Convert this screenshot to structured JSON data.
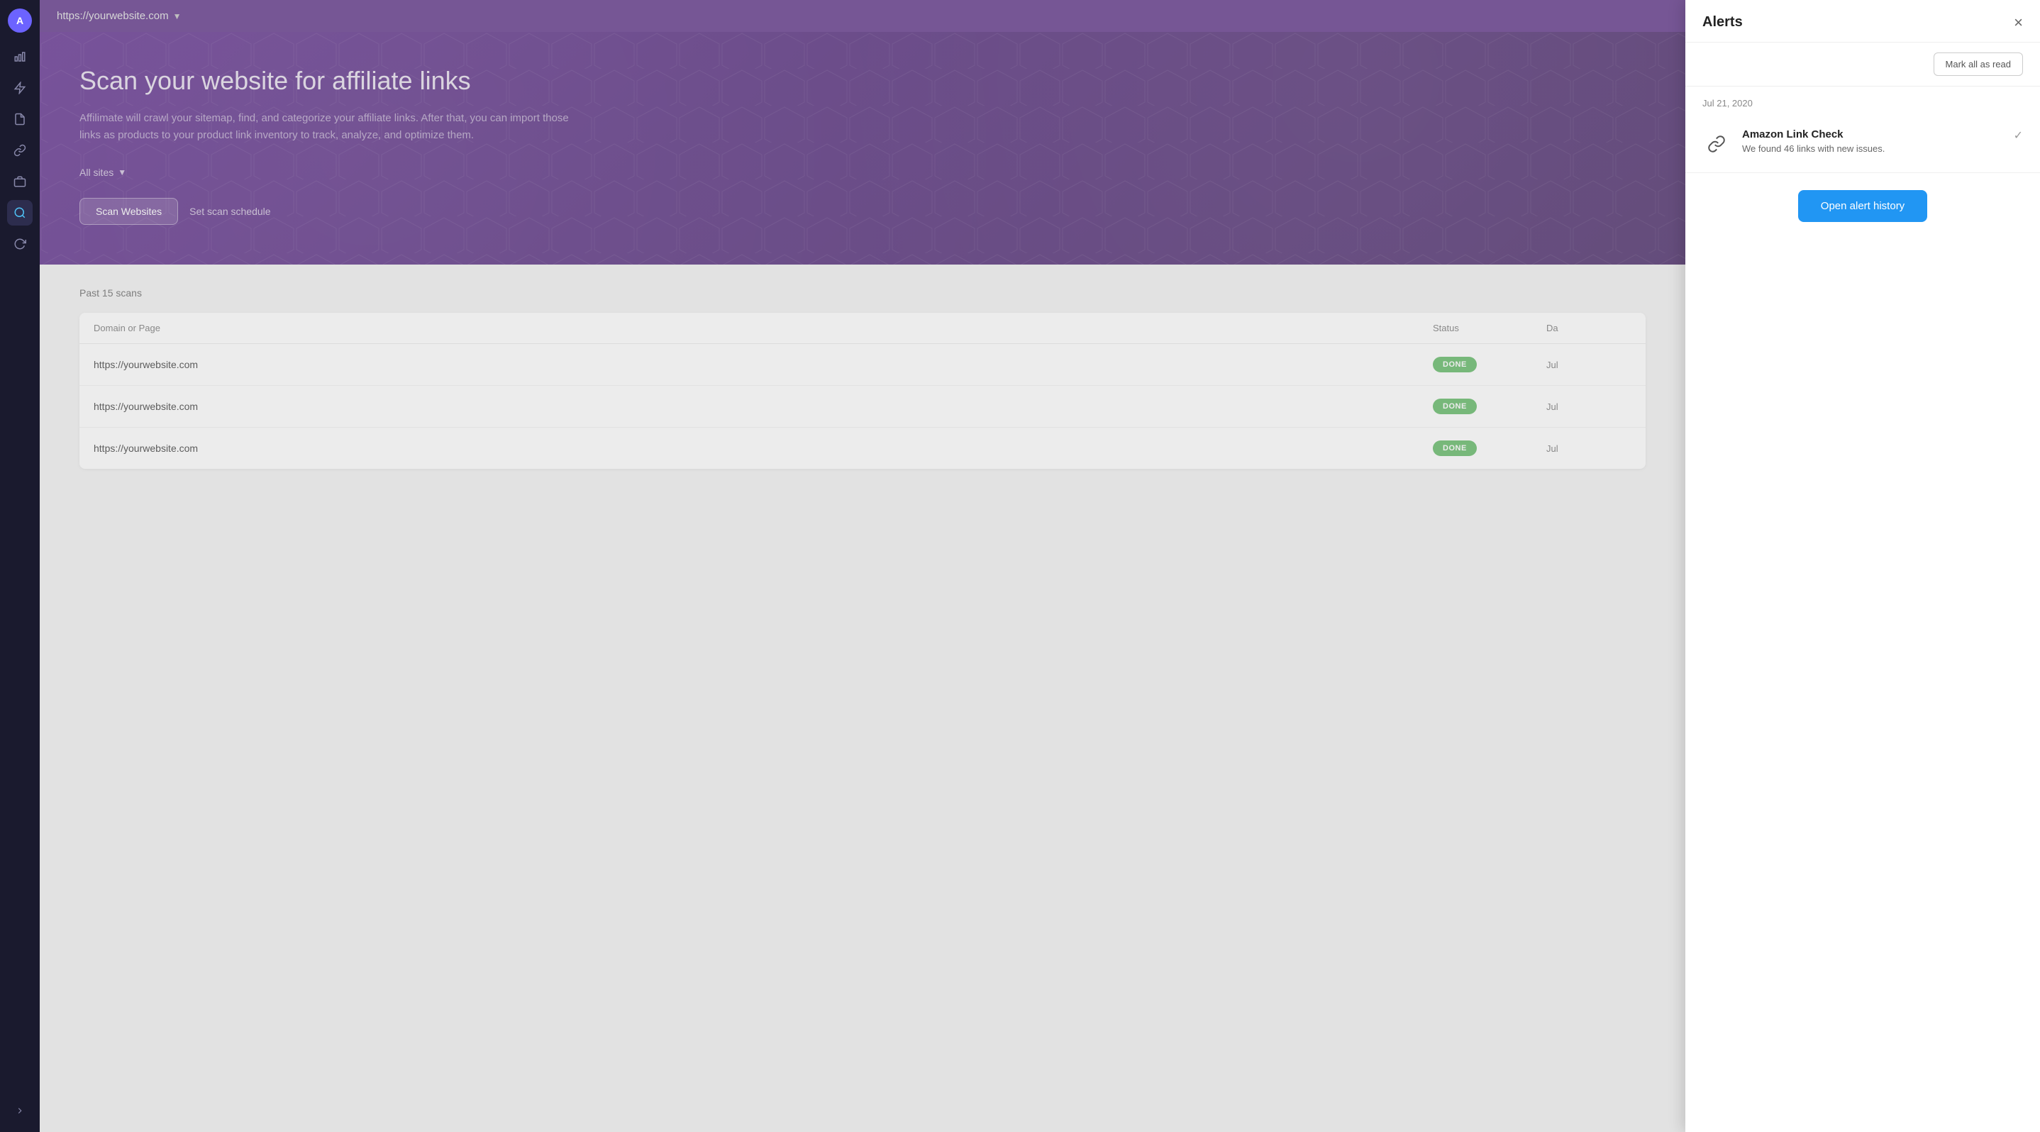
{
  "sidebar": {
    "avatar_label": "A",
    "icons": [
      {
        "name": "analytics-icon",
        "symbol": "📊"
      },
      {
        "name": "lightning-icon",
        "symbol": "⚡"
      },
      {
        "name": "document-icon",
        "symbol": "📄"
      },
      {
        "name": "link-icon",
        "symbol": "🔗"
      },
      {
        "name": "briefcase-icon",
        "symbol": "💼"
      },
      {
        "name": "search-icon",
        "symbol": "🔍",
        "active": true
      },
      {
        "name": "refresh-icon",
        "symbol": "🔄"
      }
    ],
    "expand_label": ">"
  },
  "topbar": {
    "url": "https://yourwebsite.com",
    "chevron": "▼"
  },
  "hero": {
    "title": "Scan your website for affiliate links",
    "subtitle": "Affilimate will crawl your sitemap, find, and categorize your affiliate links. After that, you can import those links as products to your product link inventory to track, analyze, and optimize them.",
    "filter_label": "All sites",
    "filter_chevron": "▼",
    "scan_button": "Scan Websites",
    "schedule_button": "Set scan schedule"
  },
  "table": {
    "title": "Past 15 scans",
    "columns": [
      "Domain or Page",
      "Status",
      "Da"
    ],
    "rows": [
      {
        "domain": "https://yourwebsite.com",
        "status": "DONE",
        "date": "Jul"
      },
      {
        "domain": "https://yourwebsite.com",
        "status": "DONE",
        "date": "Jul"
      },
      {
        "domain": "https://yourwebsite.com",
        "status": "DONE",
        "date": "Jul"
      }
    ]
  },
  "alerts": {
    "title": "Alerts",
    "close_label": "×",
    "mark_read_label": "Mark all as read",
    "date_label": "Jul 21, 2020",
    "items": [
      {
        "icon": "🔗",
        "title": "Amazon Link Check",
        "description": "We found 46 links with new issues."
      }
    ],
    "open_history_label": "Open alert history"
  }
}
